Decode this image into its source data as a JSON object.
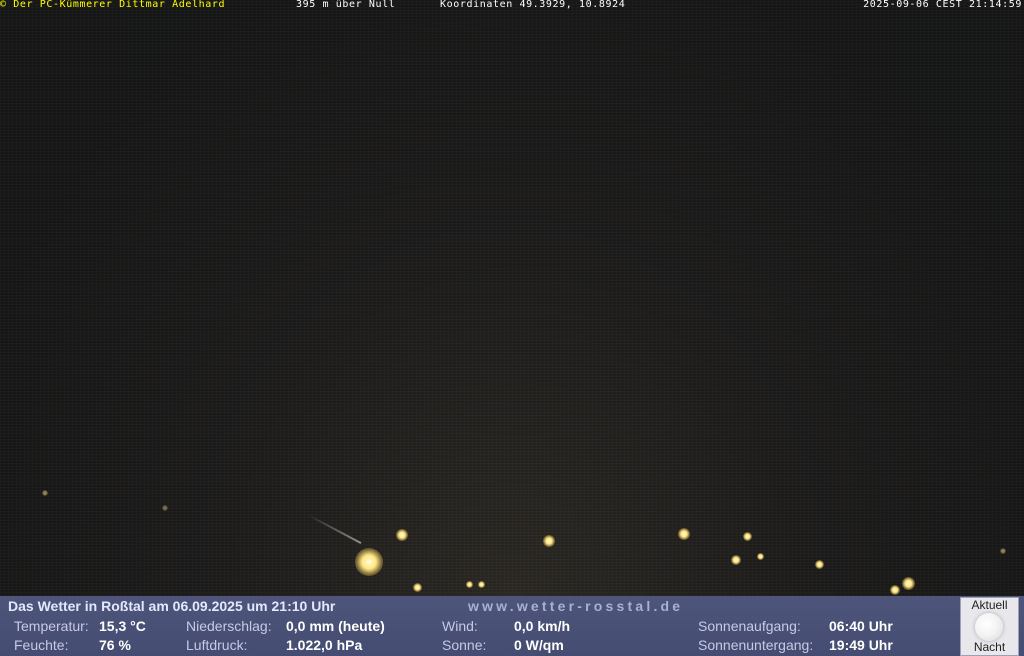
{
  "overlay": {
    "copyright": "© Der PC-Kümmerer Dittmar Adelhard",
    "altitude": "395 m über Null",
    "coordinates": "Koordinaten 49.3929, 10.8924",
    "datetime": "2025-09-06 CEST 21:14:59"
  },
  "weather": {
    "title": "Das Wetter in Roßtal am 06.09.2025 um 21:10 Uhr",
    "url": "www.wetter-rosstal.de",
    "temperature_label": "Temperatur:",
    "temperature_value": "15,3 °C",
    "humidity_label": "Feuchte:",
    "humidity_value": "76 %",
    "precip_label": "Niederschlag:",
    "precip_value": "0,0 mm (heute)",
    "pressure_label": "Luftdruck:",
    "pressure_value": "1.022,0 hPa",
    "wind_label": "Wind:",
    "wind_value": "0,0 km/h",
    "sun_label": "Sonne:",
    "sun_value": "0 W/qm",
    "sunrise_label": "Sonnenaufgang:",
    "sunrise_value": "06:40 Uhr",
    "sunset_label": "Sonnenuntergang:",
    "sunset_value": "19:49 Uhr"
  },
  "moon": {
    "top_label": "Aktuell",
    "bottom_label": "Nacht",
    "icon": "moon-icon"
  }
}
